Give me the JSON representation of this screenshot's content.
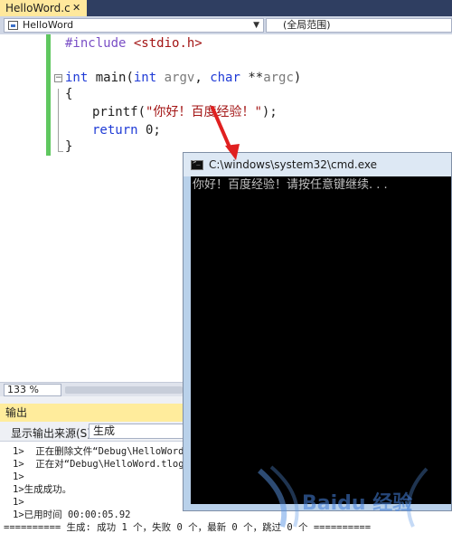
{
  "ide": {
    "tab_title": "HelloWord.c",
    "tab_close": "✕",
    "nav_left": "HelloWord",
    "nav_right": "(全局范围)",
    "code": {
      "include_directive": "#include",
      "include_file": "<stdio.h>",
      "kw_int": "int",
      "main_name": " main(",
      "param1": "argv",
      "comma": ", ",
      "kw_char": "char",
      "stars": " **",
      "param2": "argc",
      "close_paren": ")",
      "open_brace": "{",
      "printf_call": "printf(",
      "printf_string": "\"你好！百度经验！\"",
      "printf_end": ");",
      "kw_return": "return",
      "return_value": " 0;",
      "close_brace": "}"
    },
    "zoom_level": "133 %",
    "output": {
      "header": "输出",
      "source_label": "显示输出来源(S):",
      "source_value": "生成",
      "lines": [
        "1>  正在删除文件“Debug\\HelloWord",
        "1>  正在对“Debug\\HelloWord.tlog\\",
        "1>",
        "1>生成成功。",
        "1>",
        "1>已用时间 00:00:05.92",
        "========== 生成: 成功 1 个，失败 0 个，最新 0 个，跳过 0 个 =========="
      ]
    }
  },
  "cmd": {
    "title": "C:\\windows\\system32\\cmd.exe",
    "output_line": "你好！百度经验！请按任意键继续. . ."
  },
  "watermark": {
    "text": "Baidu 经验"
  },
  "colors": {
    "tab_active": "#ffe89c",
    "tab_strip": "#2f3e61",
    "change_bar": "#5fc75f",
    "keyword": "#1f3bd6",
    "string": "#a31515",
    "cmd_background": "#000000",
    "arrow": "#e02020"
  }
}
